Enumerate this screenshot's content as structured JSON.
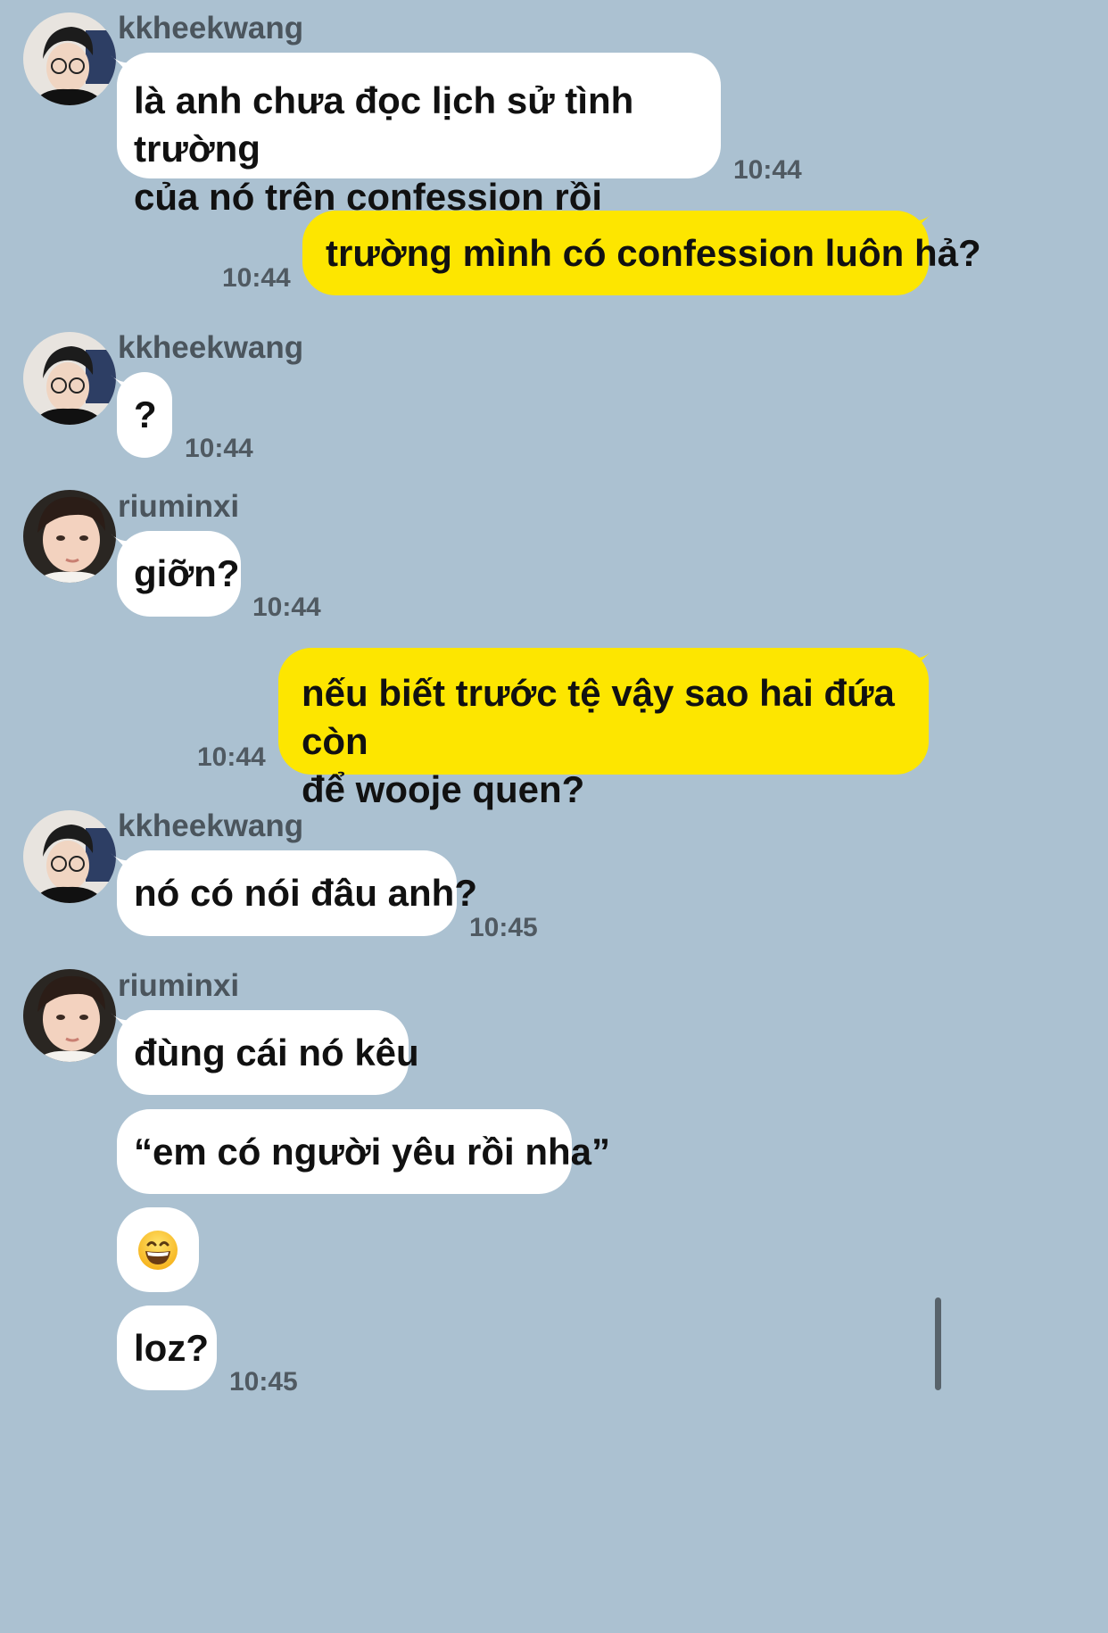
{
  "colors": {
    "background": "#abc1d1",
    "incoming_bubble": "#ffffff",
    "outgoing_bubble": "#fde600",
    "meta_text": "#505a62"
  },
  "messages": [
    {
      "direction": "in",
      "sender": "kkheekwang",
      "text": "là anh chưa đọc lịch sử tình trường\ncủa nó trên confession rồi",
      "time": "10:44"
    },
    {
      "direction": "out",
      "text": "trường mình có confession luôn hả?",
      "time": "10:44"
    },
    {
      "direction": "in",
      "sender": "kkheekwang",
      "text": "?",
      "time": "10:44"
    },
    {
      "direction": "in",
      "sender": "riuminxi",
      "text": "giỡn?",
      "time": "10:44"
    },
    {
      "direction": "out",
      "text": "nếu biết trước tệ vậy sao hai đứa còn\nđể wooje quen?",
      "time": "10:44"
    },
    {
      "direction": "in",
      "sender": "kkheekwang",
      "text": "nó có nói đâu anh?",
      "time": "10:45"
    },
    {
      "direction": "in",
      "sender": "riuminxi",
      "text": "đùng cái nó kêu"
    },
    {
      "direction": "in",
      "text": "“em có người yêu rồi nha”"
    },
    {
      "direction": "in",
      "emoji": "grinning-face-icon"
    },
    {
      "direction": "in",
      "text": "loz?",
      "time": "10:45"
    }
  ]
}
